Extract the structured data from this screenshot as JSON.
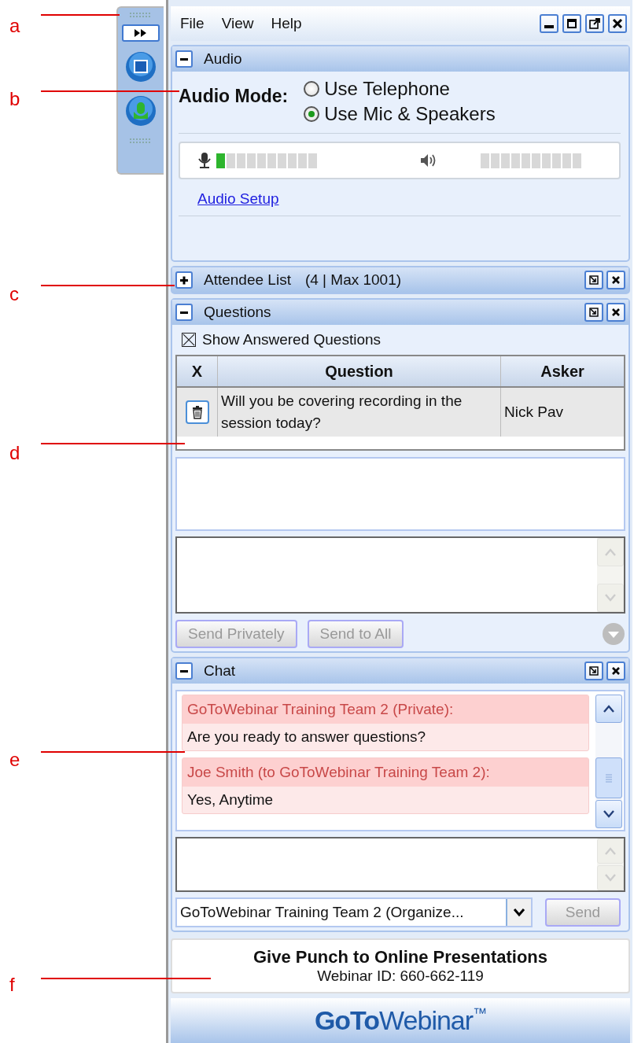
{
  "annotations": [
    {
      "label": "a"
    },
    {
      "label": "b"
    },
    {
      "label": "c"
    },
    {
      "label": "d"
    },
    {
      "label": "e"
    },
    {
      "label": "f"
    }
  ],
  "menu": [
    "File",
    "View",
    "Help"
  ],
  "audio": {
    "title": "Audio",
    "expanded": true,
    "mode_label": "Audio Mode:",
    "options": [
      {
        "label": "Use Telephone",
        "selected": false
      },
      {
        "label": "Use Mic & Speakers",
        "selected": true
      }
    ],
    "mic": {
      "level": 0.1
    },
    "setup_link": "Audio Setup"
  },
  "attendees": {
    "title": "Attendee List",
    "count": "(4 | Max 1001)",
    "expanded": false
  },
  "questions": {
    "title": "Questions",
    "expanded": true,
    "show_answered": {
      "label": "Show Answered Questions",
      "checked": true
    },
    "columns": [
      "X",
      "Question",
      "Asker"
    ],
    "rows": [
      {
        "question": "Will you be covering recording in the session today?",
        "asker": "Nick Pav"
      }
    ],
    "buttons": [
      {
        "label": "Send Privately",
        "disabled": true
      },
      {
        "label": "Send to All",
        "disabled": true
      }
    ]
  },
  "chat": {
    "title": "Chat",
    "expanded": true,
    "messages": [
      {
        "header": "GoToWebinar Training Team 2 (Private):",
        "body": "Are you ready to answer questions?"
      },
      {
        "header": "Joe Smith (to GoToWebinar Training Team 2):",
        "body": "Yes, Anytime"
      }
    ],
    "recipient": "GoToWebinar Training Team 2 (Organize...",
    "send": {
      "label": "Send",
      "disabled": true
    }
  },
  "footer": {
    "title": "Give Punch to Online Presentations",
    "webinar_id": "Webinar ID: 660-662-119"
  },
  "logo": {
    "bold": "GoTo",
    "light": "Webinar",
    "mark": "™"
  }
}
